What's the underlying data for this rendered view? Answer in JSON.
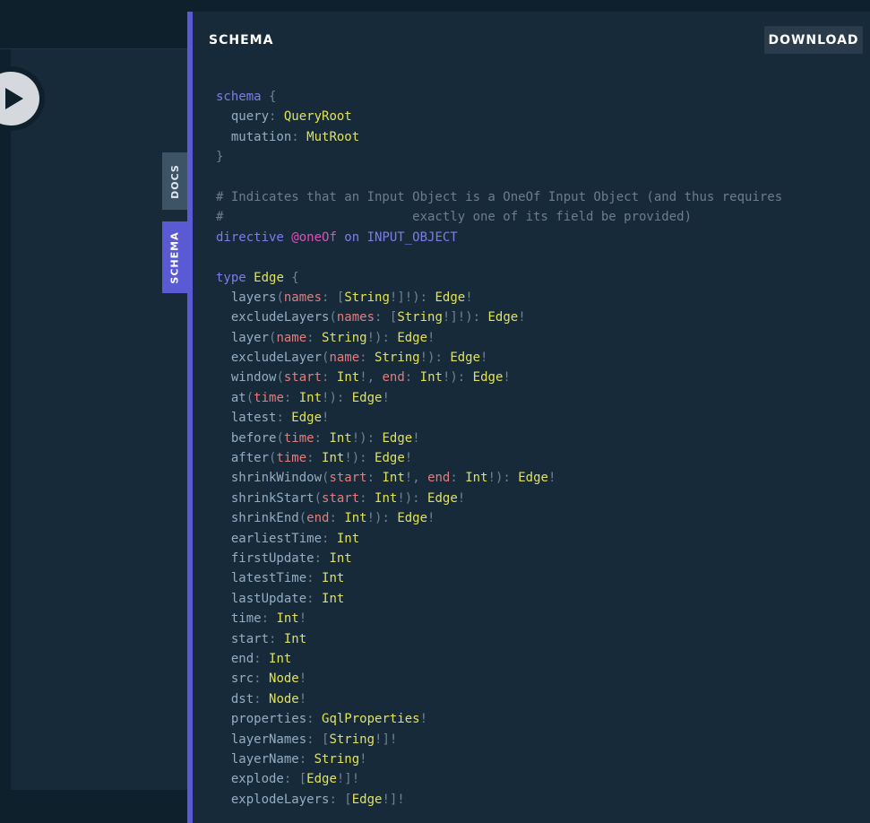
{
  "panel": {
    "title": "SCHEMA",
    "download_label": "DOWNLOAD"
  },
  "side_tabs": {
    "docs": "DOCS",
    "schema": "SCHEMA"
  },
  "icons": {
    "play": "play-icon"
  },
  "colors": {
    "accent": "#5a5ad4",
    "panel_bg": "#172a3a",
    "keyword": "#7d7de8",
    "type_name": "#e2e25a",
    "argument": "#e37d7d",
    "directive": "#d854b4",
    "comment": "#6d7d8b"
  },
  "schema_lines": [
    [
      [
        "kw",
        "schema"
      ],
      [
        "pn",
        " {"
      ]
    ],
    [
      [
        "fd",
        "  query"
      ],
      [
        "pn",
        ": "
      ],
      [
        "tn",
        "QueryRoot"
      ]
    ],
    [
      [
        "fd",
        "  mutation"
      ],
      [
        "pn",
        ": "
      ],
      [
        "tn",
        "MutRoot"
      ]
    ],
    [
      [
        "pn",
        "}"
      ]
    ],
    [],
    [
      [
        "cm",
        "# Indicates that an Input Object is a OneOf Input Object (and thus requires"
      ]
    ],
    [
      [
        "cm",
        "#                         exactly one of its field be provided)"
      ]
    ],
    [
      [
        "kw",
        "directive "
      ],
      [
        "dr",
        "@oneOf"
      ],
      [
        "kw",
        " on "
      ],
      [
        "en",
        "INPUT_OBJECT"
      ]
    ],
    [],
    [
      [
        "kw",
        "type "
      ],
      [
        "tn",
        "Edge"
      ],
      [
        "pn",
        " {"
      ]
    ],
    [
      [
        "fd",
        "  layers"
      ],
      [
        "pn",
        "("
      ],
      [
        "ar",
        "names"
      ],
      [
        "pn",
        ": ["
      ],
      [
        "tn",
        "String"
      ],
      [
        "pn",
        "!]!): "
      ],
      [
        "tn",
        "Edge"
      ],
      [
        "pn",
        "!"
      ]
    ],
    [
      [
        "fd",
        "  excludeLayers"
      ],
      [
        "pn",
        "("
      ],
      [
        "ar",
        "names"
      ],
      [
        "pn",
        ": ["
      ],
      [
        "tn",
        "String"
      ],
      [
        "pn",
        "!]!): "
      ],
      [
        "tn",
        "Edge"
      ],
      [
        "pn",
        "!"
      ]
    ],
    [
      [
        "fd",
        "  layer"
      ],
      [
        "pn",
        "("
      ],
      [
        "ar",
        "name"
      ],
      [
        "pn",
        ": "
      ],
      [
        "tn",
        "String"
      ],
      [
        "pn",
        "!): "
      ],
      [
        "tn",
        "Edge"
      ],
      [
        "pn",
        "!"
      ]
    ],
    [
      [
        "fd",
        "  excludeLayer"
      ],
      [
        "pn",
        "("
      ],
      [
        "ar",
        "name"
      ],
      [
        "pn",
        ": "
      ],
      [
        "tn",
        "String"
      ],
      [
        "pn",
        "!): "
      ],
      [
        "tn",
        "Edge"
      ],
      [
        "pn",
        "!"
      ]
    ],
    [
      [
        "fd",
        "  window"
      ],
      [
        "pn",
        "("
      ],
      [
        "ar",
        "start"
      ],
      [
        "pn",
        ": "
      ],
      [
        "tn",
        "Int"
      ],
      [
        "pn",
        "!, "
      ],
      [
        "ar",
        "end"
      ],
      [
        "pn",
        ": "
      ],
      [
        "tn",
        "Int"
      ],
      [
        "pn",
        "!): "
      ],
      [
        "tn",
        "Edge"
      ],
      [
        "pn",
        "!"
      ]
    ],
    [
      [
        "fd",
        "  at"
      ],
      [
        "pn",
        "("
      ],
      [
        "ar",
        "time"
      ],
      [
        "pn",
        ": "
      ],
      [
        "tn",
        "Int"
      ],
      [
        "pn",
        "!): "
      ],
      [
        "tn",
        "Edge"
      ],
      [
        "pn",
        "!"
      ]
    ],
    [
      [
        "fd",
        "  latest"
      ],
      [
        "pn",
        ": "
      ],
      [
        "tn",
        "Edge"
      ],
      [
        "pn",
        "!"
      ]
    ],
    [
      [
        "fd",
        "  before"
      ],
      [
        "pn",
        "("
      ],
      [
        "ar",
        "time"
      ],
      [
        "pn",
        ": "
      ],
      [
        "tn",
        "Int"
      ],
      [
        "pn",
        "!): "
      ],
      [
        "tn",
        "Edge"
      ],
      [
        "pn",
        "!"
      ]
    ],
    [
      [
        "fd",
        "  after"
      ],
      [
        "pn",
        "("
      ],
      [
        "ar",
        "time"
      ],
      [
        "pn",
        ": "
      ],
      [
        "tn",
        "Int"
      ],
      [
        "pn",
        "!): "
      ],
      [
        "tn",
        "Edge"
      ],
      [
        "pn",
        "!"
      ]
    ],
    [
      [
        "fd",
        "  shrinkWindow"
      ],
      [
        "pn",
        "("
      ],
      [
        "ar",
        "start"
      ],
      [
        "pn",
        ": "
      ],
      [
        "tn",
        "Int"
      ],
      [
        "pn",
        "!, "
      ],
      [
        "ar",
        "end"
      ],
      [
        "pn",
        ": "
      ],
      [
        "tn",
        "Int"
      ],
      [
        "pn",
        "!): "
      ],
      [
        "tn",
        "Edge"
      ],
      [
        "pn",
        "!"
      ]
    ],
    [
      [
        "fd",
        "  shrinkStart"
      ],
      [
        "pn",
        "("
      ],
      [
        "ar",
        "start"
      ],
      [
        "pn",
        ": "
      ],
      [
        "tn",
        "Int"
      ],
      [
        "pn",
        "!): "
      ],
      [
        "tn",
        "Edge"
      ],
      [
        "pn",
        "!"
      ]
    ],
    [
      [
        "fd",
        "  shrinkEnd"
      ],
      [
        "pn",
        "("
      ],
      [
        "ar",
        "end"
      ],
      [
        "pn",
        ": "
      ],
      [
        "tn",
        "Int"
      ],
      [
        "pn",
        "!): "
      ],
      [
        "tn",
        "Edge"
      ],
      [
        "pn",
        "!"
      ]
    ],
    [
      [
        "fd",
        "  earliestTime"
      ],
      [
        "pn",
        ": "
      ],
      [
        "tn",
        "Int"
      ]
    ],
    [
      [
        "fd",
        "  firstUpdate"
      ],
      [
        "pn",
        ": "
      ],
      [
        "tn",
        "Int"
      ]
    ],
    [
      [
        "fd",
        "  latestTime"
      ],
      [
        "pn",
        ": "
      ],
      [
        "tn",
        "Int"
      ]
    ],
    [
      [
        "fd",
        "  lastUpdate"
      ],
      [
        "pn",
        ": "
      ],
      [
        "tn",
        "Int"
      ]
    ],
    [
      [
        "fd",
        "  time"
      ],
      [
        "pn",
        ": "
      ],
      [
        "tn",
        "Int"
      ],
      [
        "pn",
        "!"
      ]
    ],
    [
      [
        "fd",
        "  start"
      ],
      [
        "pn",
        ": "
      ],
      [
        "tn",
        "Int"
      ]
    ],
    [
      [
        "fd",
        "  end"
      ],
      [
        "pn",
        ": "
      ],
      [
        "tn",
        "Int"
      ]
    ],
    [
      [
        "fd",
        "  src"
      ],
      [
        "pn",
        ": "
      ],
      [
        "tn",
        "Node"
      ],
      [
        "pn",
        "!"
      ]
    ],
    [
      [
        "fd",
        "  dst"
      ],
      [
        "pn",
        ": "
      ],
      [
        "tn",
        "Node"
      ],
      [
        "pn",
        "!"
      ]
    ],
    [
      [
        "fd",
        "  properties"
      ],
      [
        "pn",
        ": "
      ],
      [
        "tn",
        "GqlProperties"
      ],
      [
        "pn",
        "!"
      ]
    ],
    [
      [
        "fd",
        "  layerNames"
      ],
      [
        "pn",
        ": ["
      ],
      [
        "tn",
        "String"
      ],
      [
        "pn",
        "!]!"
      ]
    ],
    [
      [
        "fd",
        "  layerName"
      ],
      [
        "pn",
        ": "
      ],
      [
        "tn",
        "String"
      ],
      [
        "pn",
        "!"
      ]
    ],
    [
      [
        "fd",
        "  explode"
      ],
      [
        "pn",
        ": ["
      ],
      [
        "tn",
        "Edge"
      ],
      [
        "pn",
        "!]!"
      ]
    ],
    [
      [
        "fd",
        "  explodeLayers"
      ],
      [
        "pn",
        ": ["
      ],
      [
        "tn",
        "Edge"
      ],
      [
        "pn",
        "!]!"
      ]
    ]
  ]
}
